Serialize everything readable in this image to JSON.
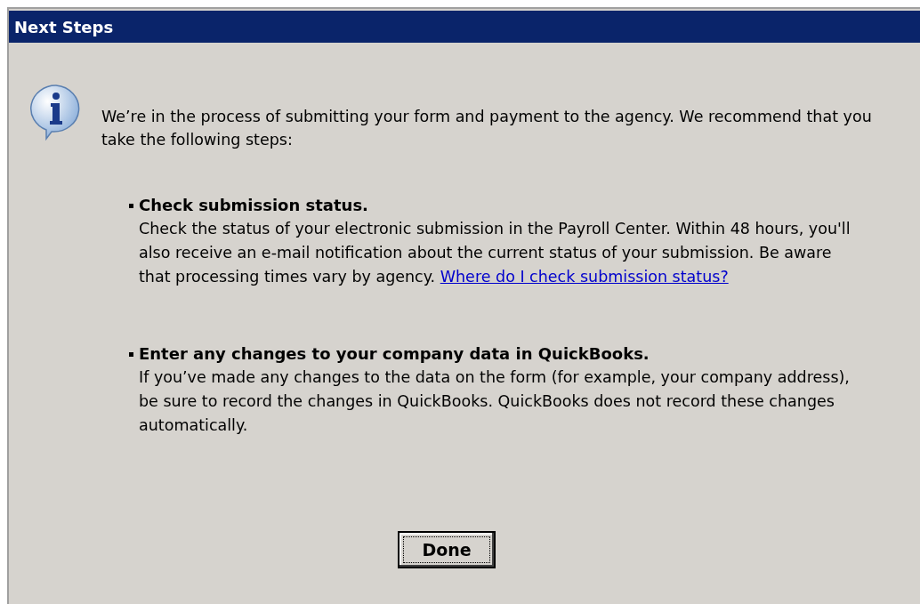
{
  "window": {
    "title": "Next Steps"
  },
  "intro": "We’re in the process of submitting your form and payment to the agency. We recommend that you take the following steps:",
  "steps": [
    {
      "title": "Check submission status.",
      "text": "Check the status of your electronic submission in the Payroll Center. Within 48 hours, you'll also receive an e-mail notification about the current status of your submission. Be aware that processing times vary by agency. ",
      "link": "Where do I check submission status?"
    },
    {
      "title": "Enter any changes to your company data in QuickBooks.",
      "text": "If you’ve made any changes to the data on the form (for example, your company address), be sure to record the changes in QuickBooks. QuickBooks does not record these changes automatically."
    }
  ],
  "buttons": [
    {
      "label": "Done",
      "default": true
    }
  ]
}
